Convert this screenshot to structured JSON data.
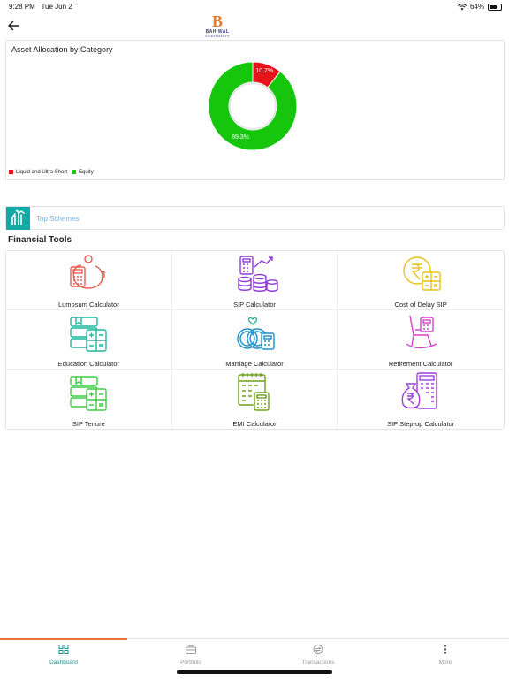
{
  "status_bar": {
    "time": "9:28 PM",
    "date": "Tue Jun 2",
    "battery": "64%",
    "battery_level": 0.64
  },
  "header": {
    "logo_mark": "B",
    "logo_name": "BAHIWAL",
    "logo_sub": "INVESTMENTS"
  },
  "allocation": {
    "title": "Asset Allocation by Category",
    "legend": [
      {
        "label": "Liquid and Ultra Short",
        "color": "#e8131a"
      },
      {
        "label": "Equity",
        "color": "#16c60c"
      }
    ]
  },
  "chart_data": {
    "type": "pie",
    "title": "Asset Allocation by Category",
    "categories": [
      "Liquid and Ultra Short",
      "Equity"
    ],
    "values": [
      10.7,
      89.3
    ],
    "labels": [
      "10.7%",
      "89.3%"
    ],
    "colors": [
      "#e8131a",
      "#16c60c"
    ],
    "legend_position": "bottom-left"
  },
  "top_schemes": {
    "label": "Top Schemes"
  },
  "financial_tools": {
    "title": "Financial Tools",
    "items": [
      {
        "label": "Lumpsum Calculator",
        "icon": "piggy-bank-calculator-icon",
        "color": "#ec5b50"
      },
      {
        "label": "SIP Calculator",
        "icon": "coins-calculator-icon",
        "color": "#8e3bd8"
      },
      {
        "label": "Cost of Delay SIP",
        "icon": "rupee-calculator-icon",
        "color": "#e6c21b"
      },
      {
        "label": "Education Calculator",
        "icon": "books-calculator-icon",
        "color": "#1bb89c"
      },
      {
        "label": "Marriage Calculator",
        "icon": "rings-calculator-icon",
        "color": "#1a8fc8"
      },
      {
        "label": "Retirement Calculator",
        "icon": "rocking-chair-icon",
        "color": "#d93fcf"
      },
      {
        "label": "SIP Tenure",
        "icon": "books-calculator-icon",
        "color": "#3ccd43"
      },
      {
        "label": "EMI Calculator",
        "icon": "calendar-calculator-icon",
        "color": "#6f9f1d"
      },
      {
        "label": "SIP Step-up Calculator",
        "icon": "money-bag-calculator-icon",
        "color": "#9b3ee0"
      }
    ]
  },
  "tabs": [
    {
      "label": "Dashboard",
      "icon": "grid-icon",
      "active": true
    },
    {
      "label": "Portfolio",
      "icon": "briefcase-icon",
      "active": false
    },
    {
      "label": "Transactions",
      "icon": "exchange-icon",
      "active": false
    },
    {
      "label": "More",
      "icon": "more-vertical-icon",
      "active": false
    }
  ]
}
